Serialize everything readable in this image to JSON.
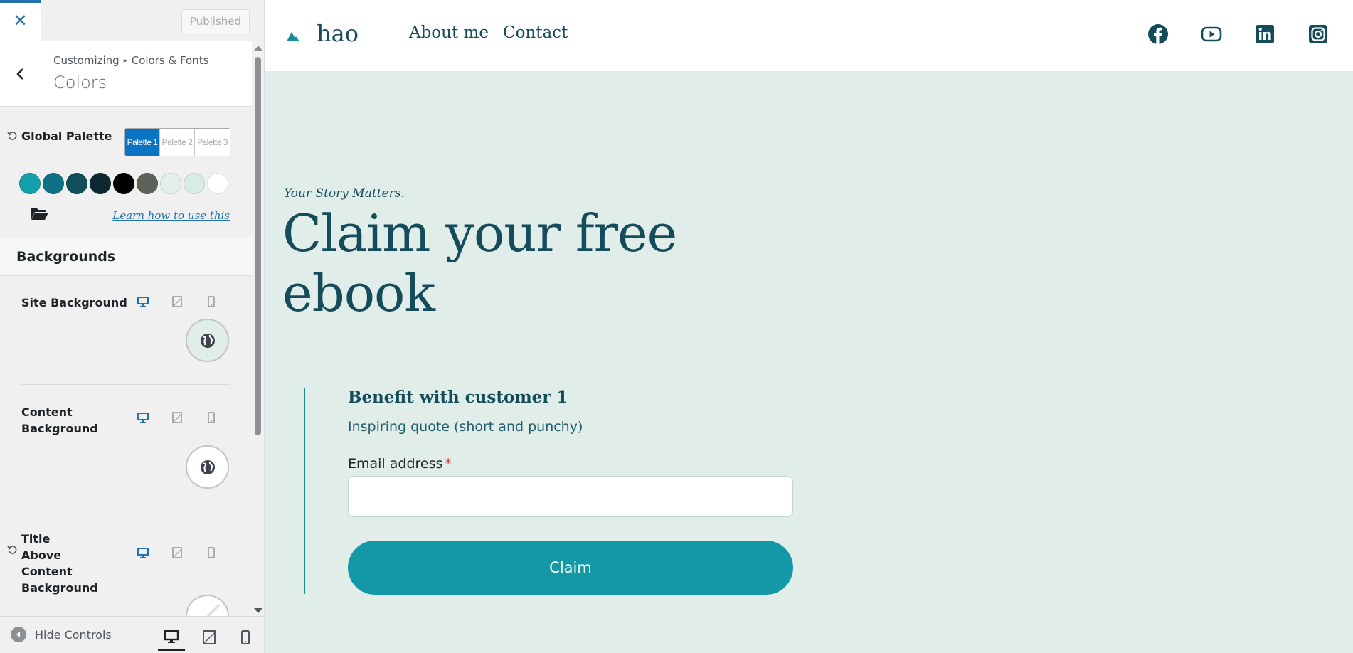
{
  "topbar": {
    "close_icon": "close-icon",
    "published_label": "Published"
  },
  "section": {
    "breadcrumb_root": "Customizing",
    "breadcrumb_sep": "▸",
    "breadcrumb_parent": "Colors & Fonts",
    "title": "Colors"
  },
  "global_palette": {
    "label": "Global Palette",
    "tabs": [
      "Palette 1",
      "Palette 2",
      "Palette 3"
    ],
    "active_tab": "Palette 1",
    "swatches": [
      "#14a0a8",
      "#0f7085",
      "#114e5b",
      "#0d2830",
      "#000000",
      "#5d6358",
      "#e2f0ec",
      "#d9ebe5",
      "#ffffff"
    ],
    "learn_link": "Learn how to use this"
  },
  "backgrounds": {
    "heading": "Backgrounds",
    "controls": [
      {
        "label": "Site Background",
        "swatch": "#e0ede9"
      },
      {
        "label": "Content Background",
        "swatch": "#ffffff"
      },
      {
        "label": "Title Above Content Background",
        "swatch": "none"
      }
    ]
  },
  "footer": {
    "hide_controls": "Hide Controls"
  },
  "site": {
    "logo": "hao",
    "nav": [
      "About me",
      "Contact"
    ],
    "social_icons": [
      "facebook-icon",
      "youtube-icon",
      "linkedin-icon",
      "instagram-icon"
    ],
    "tagline": "Your Story Matters.",
    "hero_title": "Claim your free ebook",
    "benefit_title": "Benefit with customer 1",
    "benefit_quote": "Inspiring quote (short and punchy)",
    "email_label": "Email address",
    "email_required": "*",
    "claim_button": "Claim",
    "colors": {
      "primary": "#154c5b",
      "accent": "#1399a5",
      "background": "#e0ede9",
      "admin_blue": "#2271b1"
    }
  }
}
